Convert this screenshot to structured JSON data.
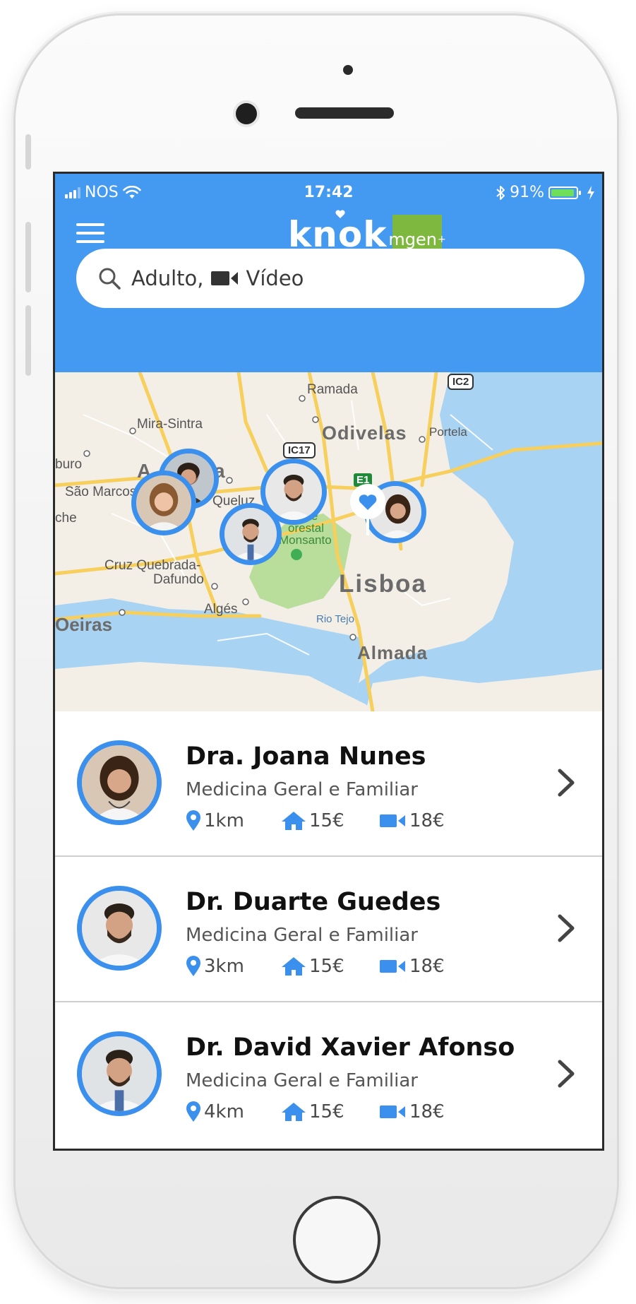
{
  "status_bar": {
    "carrier": "NOS",
    "time": "17:42",
    "battery": "91%"
  },
  "header": {
    "brand": "knok",
    "partner": "mgen"
  },
  "search": {
    "adult": "Adulto,",
    "mode": "Vídeo"
  },
  "map": {
    "labels": {
      "ramada": "Ramada",
      "mira_sintra": "Mira-Sintra",
      "odivelas": "Odivelas",
      "portela": "Portela",
      "ic2": "IC2",
      "ic17": "IC17",
      "e1": "E1",
      "buro": "buro",
      "amadora_a": "A",
      "amadora_a2": "a",
      "sao_marcos": "São Marcos",
      "che": "che",
      "queluz": "Queluz",
      "parque1": "que",
      "parque2": "orestal",
      "parque3": "Monsanto",
      "cruz1": "Cruz Quebrada-",
      "cruz2": "Dafundo",
      "lisboa": "Lisboa",
      "alges": "Algés",
      "oeiras": "Oeiras",
      "rio_tejo": "Rio Tejo",
      "almada": "Almada"
    }
  },
  "doctors": [
    {
      "name": "Dra. Joana Nunes",
      "specialty": "Medicina Geral e Familiar",
      "distance": "1km",
      "home_price": "15€",
      "video_price": "18€"
    },
    {
      "name": "Dr. Duarte Guedes",
      "specialty": "Medicina Geral e Familiar",
      "distance": "3km",
      "home_price": "15€",
      "video_price": "18€"
    },
    {
      "name": "Dr. David Xavier Afonso",
      "specialty": "Medicina Geral e Familiar",
      "distance": "4km",
      "home_price": "15€",
      "video_price": "18€"
    }
  ],
  "colors": {
    "brand_blue": "#4499f0",
    "pin_blue": "#3b90ee",
    "mgen_green": "#7fb83e",
    "park_green": "#b9dd9a",
    "water": "#a9d3f2",
    "road": "#f6cf5c"
  },
  "icons": [
    "menu-icon",
    "search-icon",
    "video-camera-icon",
    "location-pin-icon",
    "home-icon",
    "chevron-right-icon",
    "wifi-icon",
    "bluetooth-icon",
    "heart-icon"
  ]
}
